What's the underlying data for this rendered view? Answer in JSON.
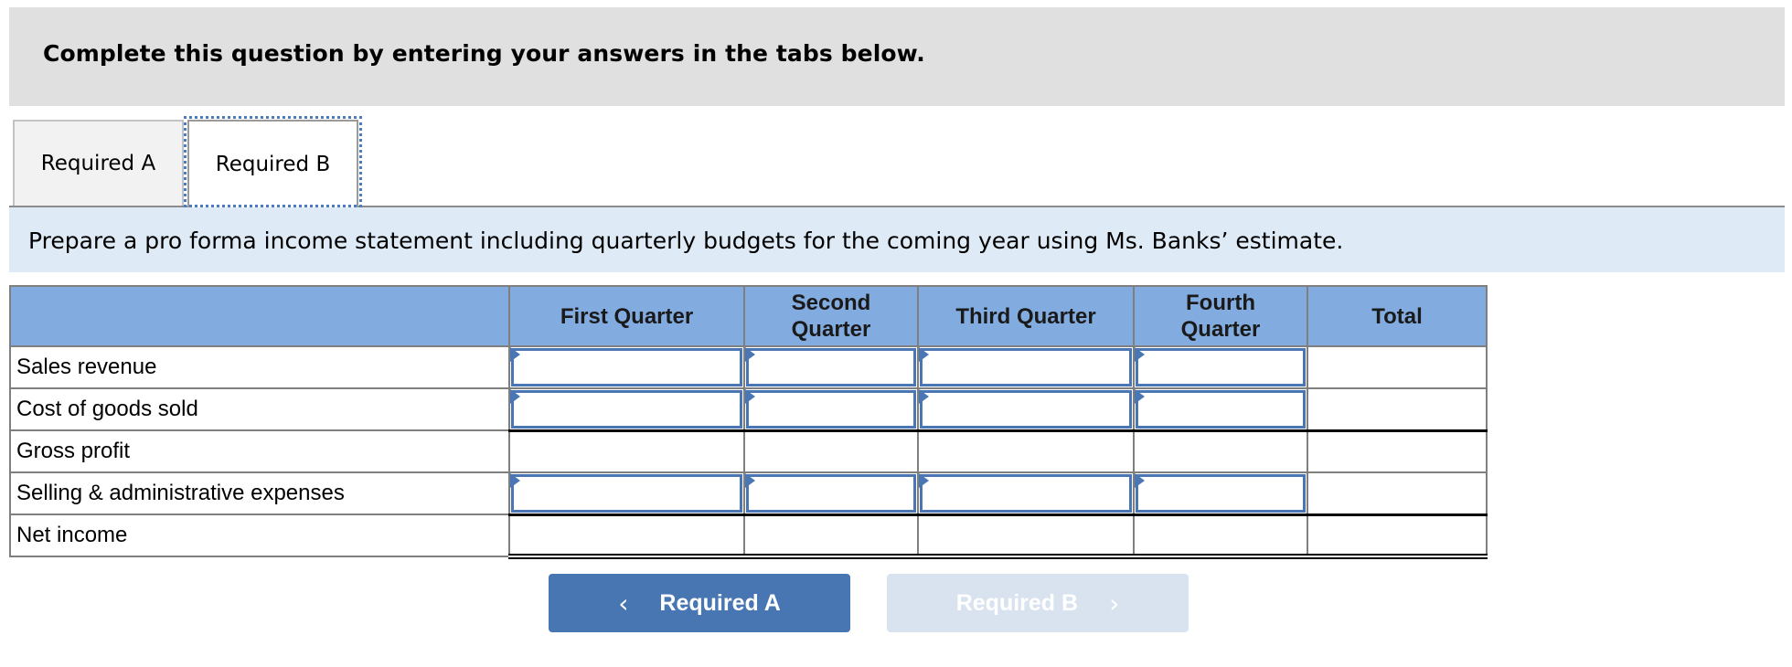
{
  "header": {
    "title": "Complete this question by entering your answers in the tabs below."
  },
  "tabs": [
    {
      "label": "Required A",
      "active": false
    },
    {
      "label": "Required B",
      "active": true
    }
  ],
  "instruction": "Prepare a pro forma income statement including quarterly budgets for the coming year using Ms. Banks’ estimate.",
  "table": {
    "columns": [
      {
        "label": ""
      },
      {
        "label": "First Quarter"
      },
      {
        "label": "Second Quarter"
      },
      {
        "label": "Third Quarter"
      },
      {
        "label": "Fourth Quarter"
      },
      {
        "label": "Total"
      }
    ],
    "rows": [
      {
        "label": "Sales revenue",
        "values": [
          "",
          "",
          "",
          "",
          ""
        ],
        "editable": true
      },
      {
        "label": "Cost of goods sold",
        "values": [
          "",
          "",
          "",
          "",
          ""
        ],
        "editable": true
      },
      {
        "label": "Gross profit",
        "values": [
          "",
          "",
          "",
          "",
          ""
        ],
        "editable": false
      },
      {
        "label": "Selling & administrative expenses",
        "values": [
          "",
          "",
          "",
          "",
          ""
        ],
        "editable": true
      },
      {
        "label": "Net income",
        "values": [
          "",
          "",
          "",
          "",
          ""
        ],
        "editable": false
      }
    ]
  },
  "nav": {
    "prev_label": "Required A",
    "prev_icon": "chevron-left-icon",
    "next_label": "Required B",
    "next_icon": "chevron-right-icon",
    "next_disabled": true
  },
  "colors": {
    "header_bg": "#e0e0e0",
    "instruction_bg": "#deeaf6",
    "table_header_bg": "#82abdf",
    "input_border": "#4a77b4",
    "nav_active_bg": "#4776b3",
    "nav_disabled_bg": "#d9e3ef"
  }
}
